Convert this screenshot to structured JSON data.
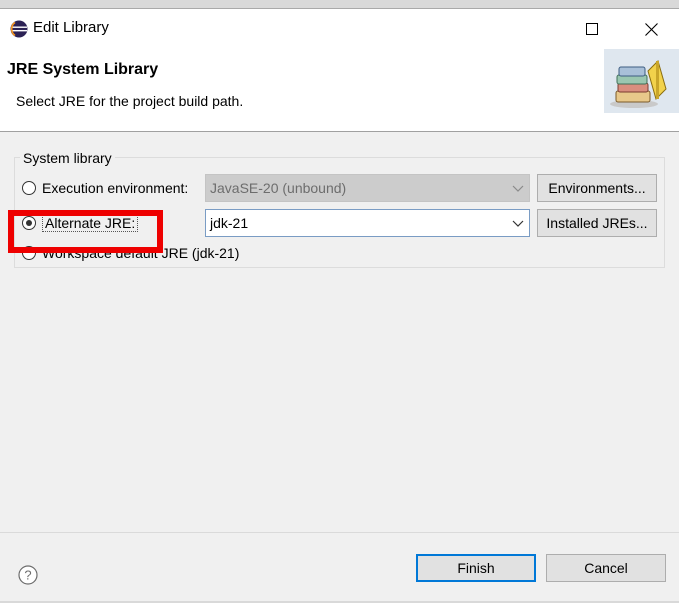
{
  "window": {
    "title": "Edit Library",
    "icons": {
      "app": "eclipse-icon",
      "minimize": "minimize-icon",
      "maximize": "maximize-icon",
      "close": "close-icon"
    }
  },
  "header": {
    "title": "JRE System Library",
    "description": "Select JRE for the project build path.",
    "image": "library-books-icon"
  },
  "system_library": {
    "group_label": "System library",
    "options": [
      {
        "label": "Execution environment:",
        "checked": false,
        "combo_value": "JavaSE-20 (unbound)",
        "combo_enabled": false,
        "button_label": "Environments..."
      },
      {
        "label": "Alternate JRE:",
        "checked": true,
        "combo_value": "jdk-21",
        "combo_enabled": true,
        "button_label": "Installed JREs..."
      },
      {
        "label": "Workspace default JRE (jdk-21)",
        "checked": false
      }
    ]
  },
  "footer": {
    "help_icon": "help-icon",
    "finish_label": "Finish",
    "cancel_label": "Cancel"
  },
  "colors": {
    "highlight": "#ee0000",
    "focus_border": "#0078d7",
    "dialog_bg": "#f0f0f0"
  }
}
